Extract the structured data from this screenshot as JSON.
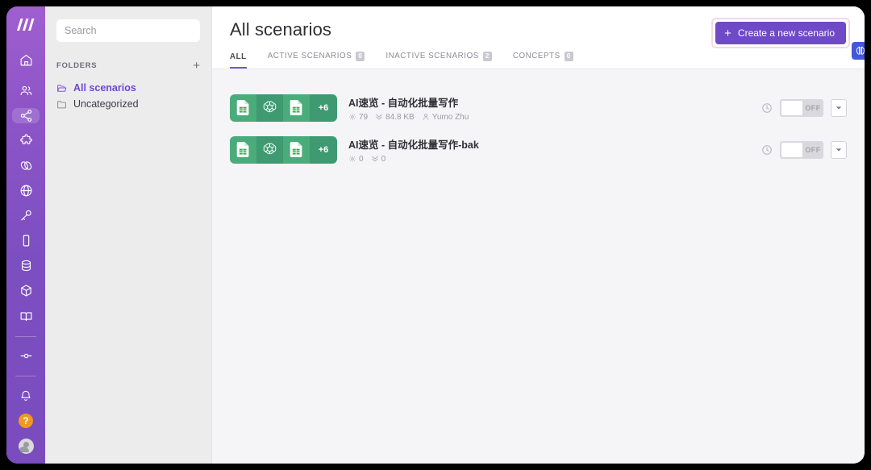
{
  "rail": {
    "logo_name": "make-logo",
    "items": [
      {
        "name": "home-icon",
        "label": "Home",
        "active": false
      },
      {
        "name": "organization-icon",
        "label": "Organization",
        "active": false
      },
      {
        "name": "scenarios-icon",
        "label": "Scenarios",
        "active": true
      },
      {
        "name": "templates-icon",
        "label": "Templates",
        "active": false
      },
      {
        "name": "connections-icon",
        "label": "Connections",
        "active": false
      },
      {
        "name": "webhooks-icon",
        "label": "Webhooks",
        "active": false
      },
      {
        "name": "keys-icon",
        "label": "Keys",
        "active": false
      },
      {
        "name": "devices-icon",
        "label": "Devices",
        "active": false
      },
      {
        "name": "data-stores-icon",
        "label": "Data stores",
        "active": false
      },
      {
        "name": "data-structures-icon",
        "label": "Data structures",
        "active": false
      },
      {
        "name": "learning-icon",
        "label": "Learning",
        "active": false
      }
    ],
    "node_item": {
      "name": "custom-apps-icon",
      "label": "Custom apps"
    },
    "bell": {
      "name": "notifications-icon",
      "label": "Notifications"
    },
    "help": {
      "name": "help-icon",
      "label": "?"
    },
    "avatar": {
      "name": "avatar",
      "label": "Profile"
    }
  },
  "sidebar": {
    "search": {
      "value": "",
      "placeholder": "Search"
    },
    "folders_label": "FOLDERS",
    "add_folder_label": "+",
    "items": [
      {
        "label": "All scenarios",
        "icon": "folder-open-icon",
        "selected": true
      },
      {
        "label": "Uncategorized",
        "icon": "folder-icon",
        "selected": false
      }
    ]
  },
  "header": {
    "title": "All scenarios",
    "create_button": {
      "label": "Create a new scenario",
      "plus": "+"
    },
    "tabs": [
      {
        "label": "ALL",
        "count": null,
        "active": true
      },
      {
        "label": "ACTIVE SCENARIOS",
        "count": "0",
        "active": false
      },
      {
        "label": "INACTIVE SCENARIOS",
        "count": "2",
        "active": false
      },
      {
        "label": "CONCEPTS",
        "count": "0",
        "active": false
      }
    ]
  },
  "scenarios": [
    {
      "name": "AI速览 - 自动化批量写作",
      "tiles": [
        {
          "icon": "google-sheets-icon",
          "shade": "a"
        },
        {
          "icon": "openai-icon",
          "shade": "b"
        },
        {
          "icon": "google-sheets-icon",
          "shade": "a"
        }
      ],
      "more_badge": "+6",
      "operations": "79",
      "data_transfer": "84.8 KB",
      "owner": "Yumo Zhu",
      "toggle_label": "OFF",
      "toggle_on": false
    },
    {
      "name": "AI速览 - 自动化批量写作-bak",
      "tiles": [
        {
          "icon": "google-sheets-icon",
          "shade": "a"
        },
        {
          "icon": "openai-icon",
          "shade": "b"
        },
        {
          "icon": "google-sheets-icon",
          "shade": "a"
        }
      ],
      "more_badge": "+6",
      "operations": "0",
      "data_transfer": "0",
      "owner": "",
      "toggle_label": "OFF",
      "toggle_on": false
    }
  ],
  "ai_tab": {
    "name": "ai-assistant-icon",
    "label": "AI assistant"
  },
  "colors": {
    "brand_purple": "#6f49c6",
    "rail_purple": "#7c4fc0",
    "accent_link": "#6d4acb",
    "tile_green_light": "#4aab7b",
    "tile_green_dark": "#3f9a72",
    "help_orange": "#f0991f",
    "ai_blue": "#4457d8",
    "focus_ring_pink": "#f6d7e6"
  }
}
